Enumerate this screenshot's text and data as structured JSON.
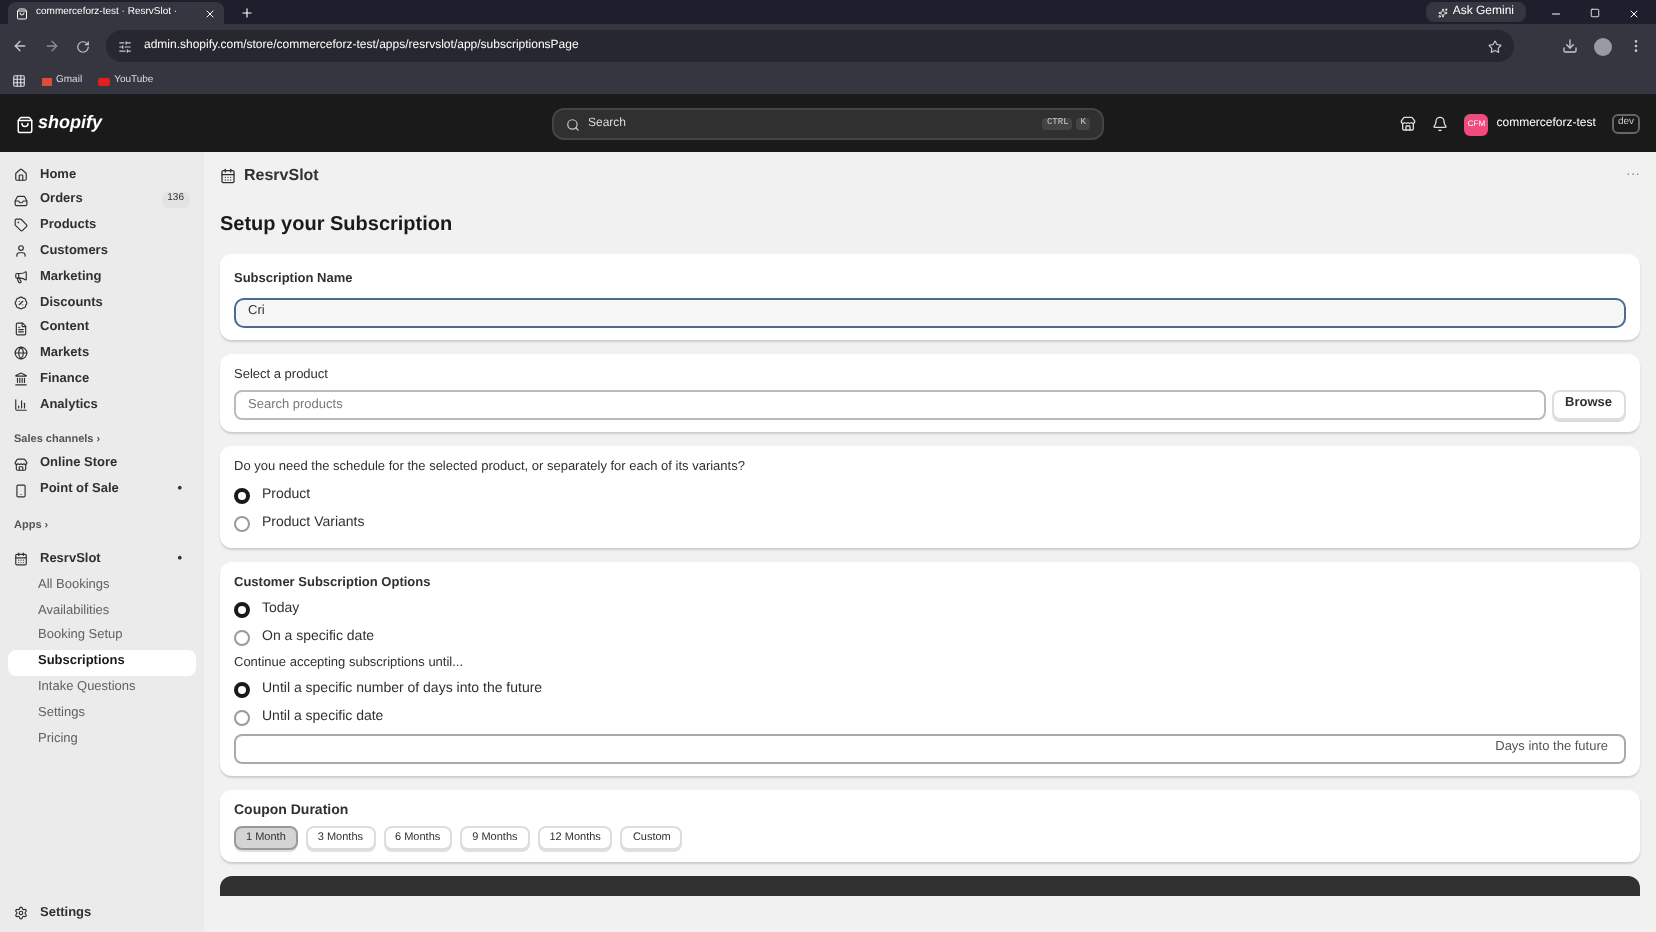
{
  "browser": {
    "tab_title": "commerceforz-test · ResrvSlot ·",
    "ask_button": "Ask Gemini",
    "url": "admin.shopify.com/store/commerceforz-test/apps/resrvslot/app/subscriptionsPage",
    "bookmarks": [
      "Gmail",
      "YouTube"
    ]
  },
  "topbar": {
    "logo": "shopify",
    "search_placeholder": "Search",
    "shortcut": [
      "CTRL",
      "K"
    ],
    "store_initials": "CFM",
    "store_name": "commerceforz-test",
    "store_badge": "dev"
  },
  "sidebar": {
    "items": [
      {
        "label": "Home",
        "selected": false
      },
      {
        "label": "Orders",
        "badge": "136",
        "selected": false
      },
      {
        "label": "Products",
        "selected": false
      },
      {
        "label": "Customers",
        "selected": false
      },
      {
        "label": "Marketing",
        "selected": false
      },
      {
        "label": "Discounts",
        "selected": false
      },
      {
        "label": "Content",
        "selected": false
      },
      {
        "label": "Markets",
        "selected": false
      },
      {
        "label": "Finance",
        "selected": false
      },
      {
        "label": "Analytics",
        "selected": false
      }
    ],
    "sales_channels": {
      "heading": "Sales channels ›",
      "items": [
        {
          "label": "Online Store"
        },
        {
          "label": "Point of Sale",
          "dot": "•"
        }
      ]
    },
    "apps": {
      "heading": "Apps ›",
      "app": {
        "label": "ResrvSlot",
        "dot": "•",
        "children": [
          {
            "label": "All Bookings",
            "selected": false
          },
          {
            "label": "Availabilities",
            "selected": false
          },
          {
            "label": "Booking Setup",
            "selected": false
          },
          {
            "label": "Subscriptions",
            "selected": true
          },
          {
            "label": "Intake Questions",
            "selected": false
          },
          {
            "label": "Settings",
            "selected": false
          },
          {
            "label": "Pricing",
            "selected": false
          }
        ]
      }
    },
    "footer_item": "Settings"
  },
  "app_header": {
    "title": "ResrvSlot",
    "menu": "···"
  },
  "page_title": "Setup your Subscription",
  "name_card": {
    "label": "Subscription Name",
    "value": "Cri"
  },
  "product_card": {
    "label": "Select a product",
    "placeholder": "Search products",
    "button": "Browse"
  },
  "schedule_card": {
    "question": "Do you need the schedule for the selected product, or separately for each of its variants?",
    "options": [
      {
        "label": "Product",
        "selected": true
      },
      {
        "label": "Product Variants",
        "selected": false
      }
    ]
  },
  "options_card": {
    "title": "Customer Subscription Options",
    "start_options": [
      {
        "label": "Today",
        "selected": true
      },
      {
        "label": "On a specific date",
        "selected": false
      }
    ],
    "continue_label": "Continue accepting subscriptions until...",
    "end_options": [
      {
        "label": "Until a specific number of days into the future",
        "selected": true
      },
      {
        "label": "Until a specific date",
        "selected": false
      }
    ],
    "days_suffix": "Days into the future"
  },
  "coupon_card": {
    "title": "Coupon Duration",
    "options": [
      {
        "label": "1 Month",
        "selected": true
      },
      {
        "label": "3 Months",
        "selected": false
      },
      {
        "label": "6 Months",
        "selected": false
      },
      {
        "label": "9 Months",
        "selected": false
      },
      {
        "label": "12 Months",
        "selected": false
      },
      {
        "label": "Custom",
        "selected": false
      }
    ]
  }
}
